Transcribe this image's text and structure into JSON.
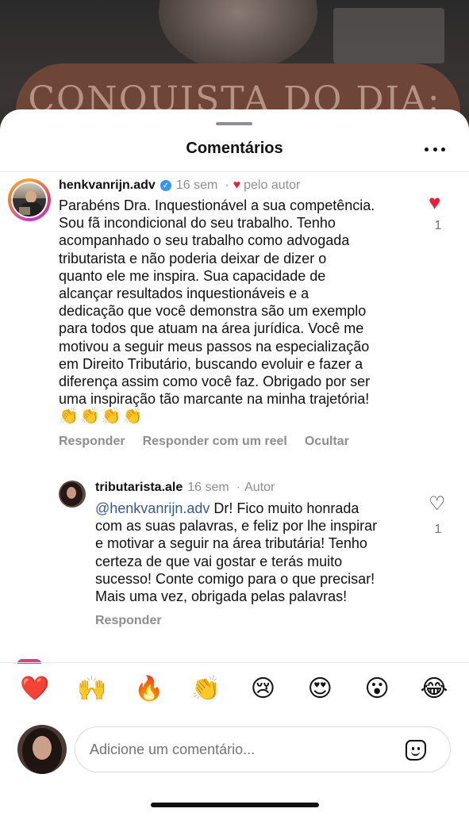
{
  "story": {
    "banner_text": "CONQUISTA DO DIA:"
  },
  "sheet": {
    "title": "Comentários"
  },
  "comments": [
    {
      "username": "henkvanrijn.adv",
      "verified": true,
      "time": "16 sem",
      "liked_by_author_label": "pelo autor",
      "text_lines": [
        "Parabéns Dra. Inquestionável a sua competência.",
        "Sou fã incondicional do seu trabalho. Tenho",
        "acompanhado o seu trabalho como advogada",
        "tributarista e não poderia deixar de dizer o",
        "quanto ele me inspira. Sua capacidade de",
        "alcançar resultados inquestionáveis e a",
        "dedicação que você demonstra  são um exemplo",
        "para todos que atuam na área jurídica. Você me",
        "motivou a seguir meus passos na especialização",
        "em Direito Tributário, buscando evoluir e fazer a",
        "diferença assim como você faz. Obrigado por ser",
        "uma inspiração tão marcante na minha trajetória!"
      ],
      "emojis": "👏👏👏👏",
      "likes": "1",
      "actions": [
        "Responder",
        "Responder com um reel",
        "Ocultar"
      ]
    },
    {
      "username": "tributarista.ale",
      "time": "16 sem",
      "role_label": "Autor",
      "mention": "@henkvanrijn.adv",
      "text_first_rest": " Dr! Fico muito honrada",
      "text_lines": [
        "com as suas palavras, e feliz por lhe inspirar",
        "e motivar a seguir na área tributária! Tenho",
        "certeza de que vai gostar e terás muito",
        "sucesso! Conte comigo para o que precisar!",
        "Mais uma vez, obrigada pelas palavras!"
      ],
      "likes": "1",
      "actions": [
        "Responder"
      ]
    }
  ],
  "reactions": [
    "❤️",
    "🙌",
    "🔥",
    "👏",
    "😢",
    "😍",
    "😮",
    "😂"
  ],
  "composer": {
    "placeholder": "Adicione um comentário..."
  },
  "icons": {
    "more": "more-options-icon",
    "sticker": "sticker-icon",
    "heart": "heart-icon",
    "verified": "verified-badge-icon"
  },
  "colors": {
    "like_red": "#ed1c3a",
    "verified_blue": "#3797f0",
    "mention_blue": "#385898",
    "muted": "#8e8e8e"
  }
}
